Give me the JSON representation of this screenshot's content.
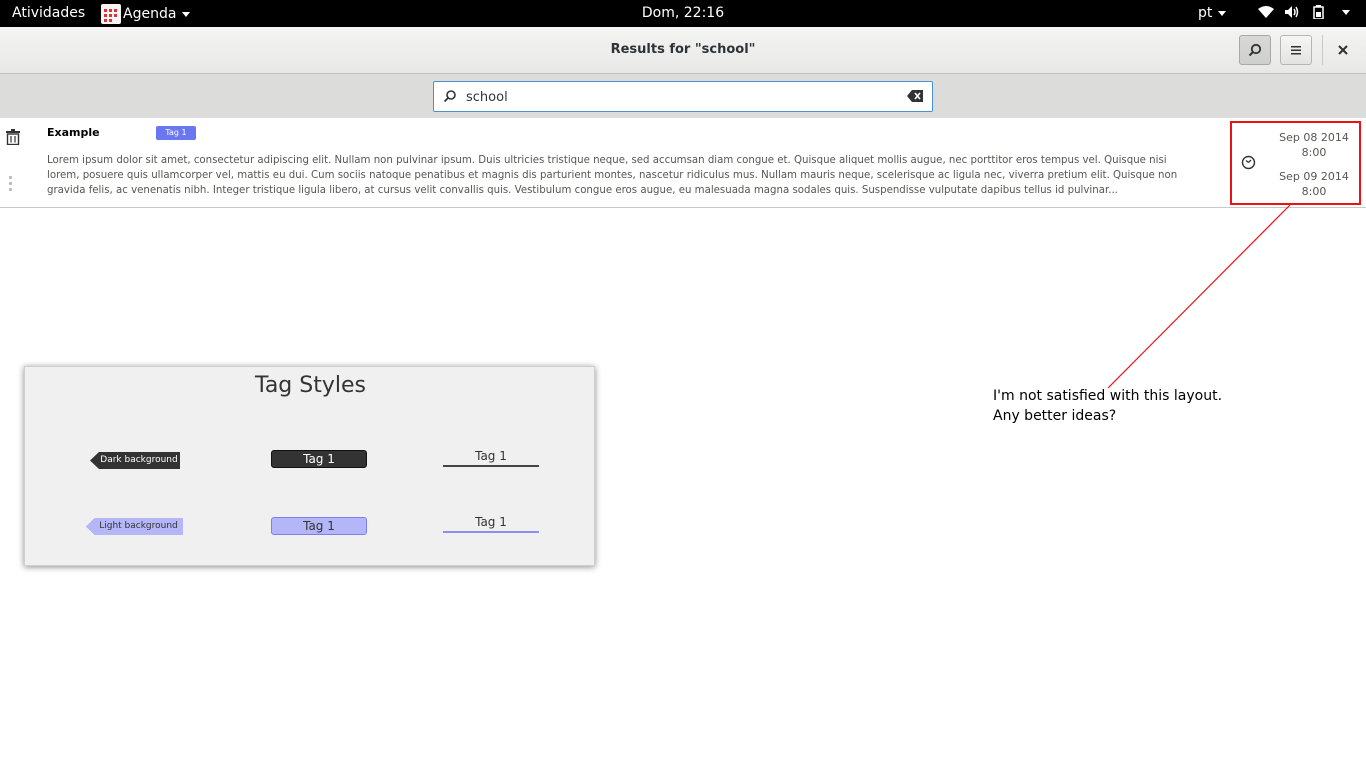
{
  "topbar": {
    "activities": "Atividades",
    "app_name": "Agenda",
    "clock": "Dom, 22:16",
    "language": "pt"
  },
  "header": {
    "title": "Results for \"school\""
  },
  "search": {
    "value": "school"
  },
  "result": {
    "name": "Example",
    "tag": "Tag 1",
    "description": "Lorem ipsum dolor sit amet, consectetur adipiscing elit. Nullam non pulvinar ipsum. Duis ultricies tristique neque, sed accumsan diam congue et. Quisque aliquet mollis augue, nec porttitor eros tempus vel. Quisque nisi lorem, posuere quis ullamcorper vel, mattis eu dui. Cum sociis natoque penatibus et magnis dis parturient montes, nascetur ridiculus mus. Nullam mauris neque, scelerisque ac ligula nec, viverra pretium elit. Quisque non gravida felis, ac venenatis nibh. Integer tristique ligula libero, at cursus velit convallis quis. Vestibulum congue eros augue, eu malesuada magna sodales quis. Suspendisse vulputate dapibus tellus id pulvinar...",
    "start_date": "Sep 08 2014",
    "start_time": "8:00",
    "end_date": "Sep 09 2014",
    "end_time": "8:00"
  },
  "annotation": {
    "line1": "I'm not satisfied with this layout.",
    "line2": "Any better ideas?",
    "color": "#e11111"
  },
  "tag_styles": {
    "title": "Tag Styles",
    "dark_arrow_label": "Dark background",
    "light_arrow_label": "Light background",
    "tag_label": "Tag 1",
    "dark_color": "#333333",
    "light_color": "#b4b6f7",
    "accent_color": "#6a78ef"
  }
}
